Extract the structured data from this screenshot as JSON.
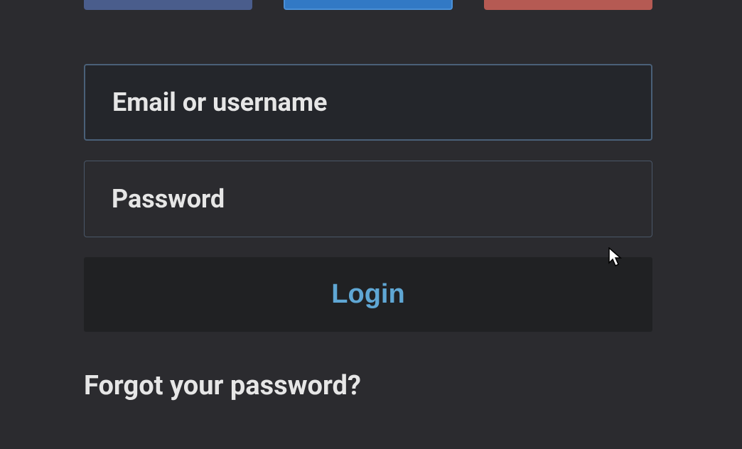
{
  "form": {
    "email_placeholder": "Email or username",
    "password_placeholder": "Password",
    "login_label": "Login",
    "forgot_label": "Forgot your password?"
  },
  "colors": {
    "bg": "#2b2b2f",
    "accent": "#5fa7d4",
    "text": "#e6e6e6",
    "border": "#4a5768",
    "social_fb": "#4a5d8c",
    "social_tw": "#3279c5",
    "social_gp": "#b55a53"
  }
}
